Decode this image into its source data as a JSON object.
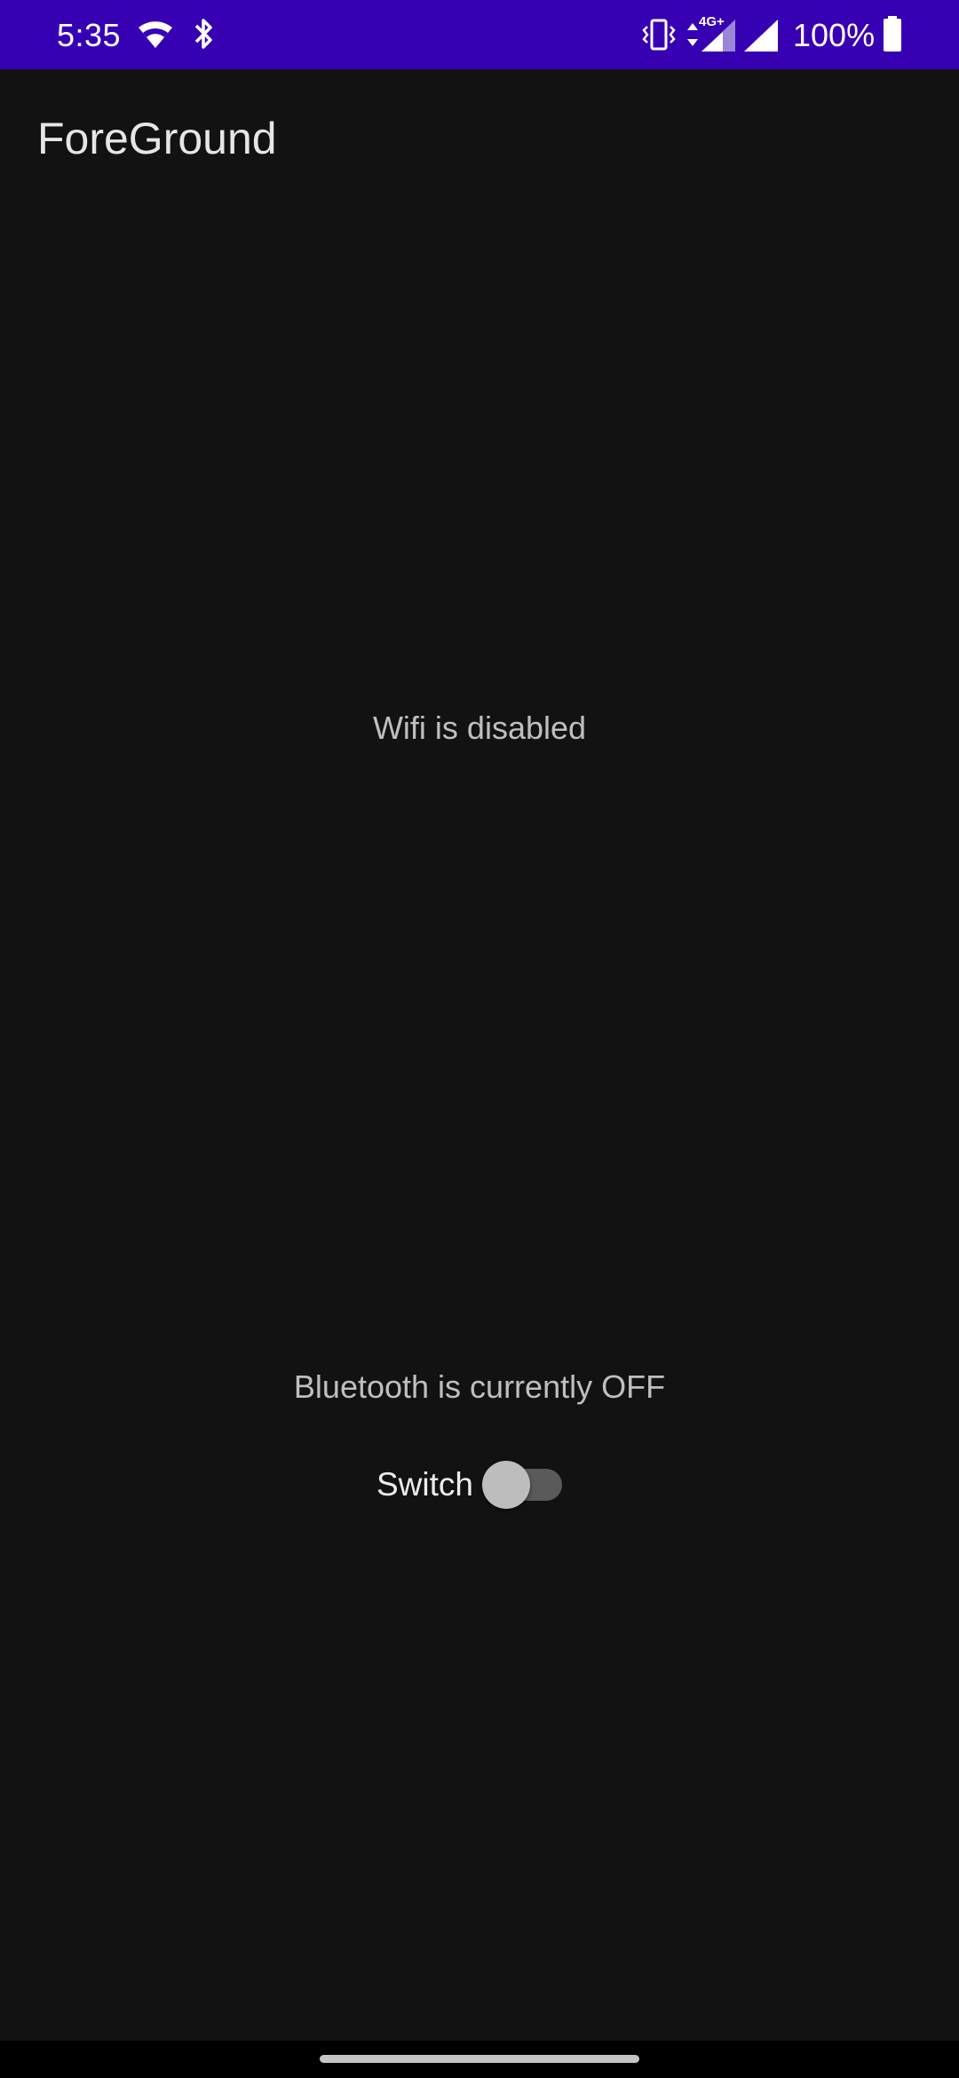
{
  "status_bar": {
    "time": "5:35",
    "network_type": "4G+",
    "battery_percent": "100%",
    "background_color": "#3700b3",
    "icons": [
      "wifi-icon",
      "bluetooth-icon",
      "vibrate-icon",
      "data-arrows-icon",
      "cell-signal-icon",
      "cell-signal-icon",
      "battery-icon"
    ]
  },
  "app_bar": {
    "title": "ForeGround"
  },
  "main": {
    "wifi_status": "Wifi is disabled",
    "bluetooth_status": "Bluetooth is currently OFF",
    "switch": {
      "label": "Switch",
      "checked": false
    }
  },
  "colors": {
    "background": "#121212",
    "text_secondary": "#bfbfbf"
  }
}
